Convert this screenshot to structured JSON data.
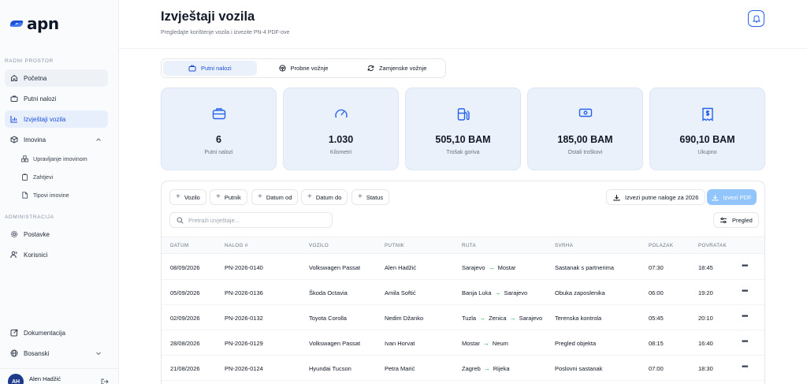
{
  "brand": {
    "name": "apn"
  },
  "sidebar": {
    "section_workspace": "RADNI PROSTOR",
    "section_admin": "ADMINISTRACIJA",
    "items": [
      {
        "label": "Početna",
        "icon": "home-icon"
      },
      {
        "label": "Putni nalozi",
        "icon": "briefcase-icon"
      },
      {
        "label": "Izvještaji vozila",
        "icon": "bar-chart-icon"
      },
      {
        "label": "Imovina",
        "icon": "cube-icon"
      }
    ],
    "sub_items": [
      {
        "label": "Upravljanje imovinom",
        "icon": "boxes-icon"
      },
      {
        "label": "Zahtjevi",
        "icon": "clipboard-icon"
      },
      {
        "label": "Tipovi imovine",
        "icon": "file-icon"
      }
    ],
    "admin_items": [
      {
        "label": "Postavke",
        "icon": "gear-icon"
      },
      {
        "label": "Korisnici",
        "icon": "users-icon"
      }
    ],
    "docs_label": "Dokumentacija",
    "language": "Bosanski",
    "user": {
      "initials": "AH",
      "name": "Alen Hadžić"
    }
  },
  "header": {
    "title": "Izvještaji vozila",
    "subtitle": "Pregledajte korištenje vozila i izvezite PN-4 PDF-ove"
  },
  "tabs": [
    {
      "label": "Putni nalozi",
      "active": true
    },
    {
      "label": "Probne vožnje",
      "active": false
    },
    {
      "label": "Zamjenske vožnje",
      "active": false
    }
  ],
  "stats": [
    {
      "value": "6",
      "label": "Putni nalozi",
      "icon": "briefcase-icon"
    },
    {
      "value": "1.030",
      "label": "Kilometri",
      "icon": "gauge-icon"
    },
    {
      "value": "505,10 BAM",
      "label": "Trošak goriva",
      "icon": "fuel-icon"
    },
    {
      "value": "185,00 BAM",
      "label": "Ostali troškovi",
      "icon": "banknote-icon"
    },
    {
      "value": "690,10 BAM",
      "label": "Ukupno",
      "icon": "receipt-icon"
    }
  ],
  "filters": [
    "Vozilo",
    "Putnik",
    "Datum od",
    "Datum do",
    "Status"
  ],
  "actions": {
    "export_year": "Izvezi putne naloge za 2026",
    "export_pdf": "Izvezi PDF",
    "view": "Pregled"
  },
  "search": {
    "placeholder": "Pretraži izvještaje...",
    "value": ""
  },
  "table": {
    "columns": [
      "DATUM",
      "NALOG #",
      "VOZILO",
      "PUTNIK",
      "RUTA",
      "SVRHA",
      "POLAZAK",
      "POVRATAK"
    ],
    "rows": [
      {
        "date": "08/09/2026",
        "order": "PN-2026-0140",
        "vehicle": "Volkswagen Passat",
        "driver": "Alen Hadžić",
        "route": [
          "Sarajevo",
          "Mostar"
        ],
        "purpose": "Sastanak s partnerima",
        "depart": "07:30",
        "return": "18:45"
      },
      {
        "date": "05/09/2026",
        "order": "PN-2026-0136",
        "vehicle": "Škoda Octavia",
        "driver": "Amila Softić",
        "route": [
          "Banja Luka",
          "Sarajevo"
        ],
        "purpose": "Obuka zaposlenika",
        "depart": "06:00",
        "return": "19:20"
      },
      {
        "date": "02/09/2026",
        "order": "PN-2026-0132",
        "vehicle": "Toyota Corolla",
        "driver": "Nedim Džanko",
        "route": [
          "Tuzla",
          "Zenica",
          "Sarajevo"
        ],
        "purpose": "Terenska kontrola",
        "depart": "05:45",
        "return": "20:10"
      },
      {
        "date": "28/08/2026",
        "order": "PN-2026-0129",
        "vehicle": "Volkswagen Passat",
        "driver": "Ivan Horvat",
        "route": [
          "Mostar",
          "Neum"
        ],
        "purpose": "Pregled objekta",
        "depart": "08:15",
        "return": "16:40"
      },
      {
        "date": "21/08/2026",
        "order": "PN-2026-0124",
        "vehicle": "Hyundai Tucson",
        "driver": "Petra Marić",
        "route": [
          "Zagreb",
          "Rijeka"
        ],
        "purpose": "Poslovni sastanak",
        "depart": "07:00",
        "return": "18:30"
      }
    ]
  },
  "colors": {
    "accent": "#2563eb",
    "active_bg": "#e6effb",
    "stat_bg": "#eaf1fb",
    "route_arrow": "#16a34a",
    "pdf_button": "#93c5fd"
  }
}
